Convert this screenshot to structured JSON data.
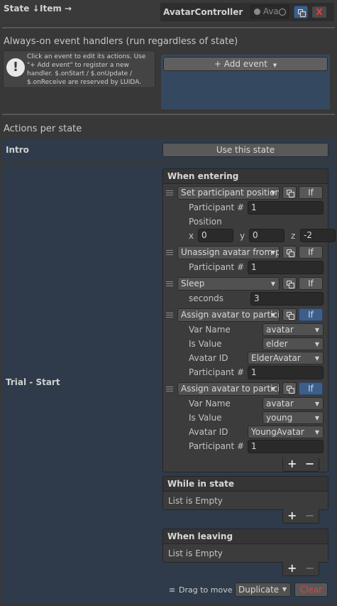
{
  "header": {
    "state_sort": "State ↓",
    "item_sort": "Item →",
    "avatar_controller_label": "AvatarController",
    "avatar_field_value": "Ava",
    "close_label": "X"
  },
  "always_on": {
    "title": "Always-on event handlers (run regardless of state)",
    "info_text": "Click an event to edit its actions. Use \"+ Add event\" to register a new handler. $.onStart / $.onUpdate / $.onReceive are reserved by LUIDA.",
    "add_event_label": "+ Add event"
  },
  "actions": {
    "title": "Actions per state",
    "intro": {
      "label": "Intro",
      "button": "Use this state"
    },
    "trial_label": "Trial - Start",
    "when_entering": {
      "title": "When entering",
      "items": [
        {
          "action": "Set participant position",
          "if_label": "If",
          "fields": {
            "participant_label": "Participant #",
            "participant_value": "1",
            "position_label": "Position",
            "x_label": "x",
            "x_value": "0",
            "y_label": "y",
            "y_value": "0",
            "z_label": "z",
            "z_value": "-2"
          }
        },
        {
          "action": "Unassign avatar from participant",
          "if_label": "If",
          "fields": {
            "participant_label": "Participant #",
            "participant_value": "1"
          }
        },
        {
          "action": "Sleep",
          "if_label": "If",
          "fields": {
            "seconds_label": "seconds",
            "seconds_value": "3"
          }
        },
        {
          "action": "Assign avatar to participant",
          "if_label": "If",
          "fields": {
            "var_name_label": "Var Name",
            "var_name_value": "avatar",
            "is_value_label": "Is Value",
            "is_value_value": "elder",
            "avatar_id_label": "Avatar ID",
            "avatar_id_value": "ElderAvatar",
            "participant_label": "Participant #",
            "participant_value": "1"
          }
        },
        {
          "action": "Assign avatar to participant",
          "if_label": "If",
          "fields": {
            "var_name_label": "Var Name",
            "var_name_value": "avatar",
            "is_value_label": "Is Value",
            "is_value_value": "young",
            "avatar_id_label": "Avatar ID",
            "avatar_id_value": "YoungAvatar",
            "participant_label": "Participant #",
            "participant_value": "1"
          }
        }
      ],
      "add_label": "+",
      "remove_label": "−"
    },
    "while_in_state": {
      "title": "While in state",
      "empty": "List is Empty",
      "add_label": "+",
      "remove_label": "−"
    },
    "when_leaving": {
      "title": "When leaving",
      "empty": "List is Empty",
      "add_label": "+",
      "remove_label": "−"
    },
    "footer": {
      "drag_label": "Drag to move",
      "duplicate_label": "Duplicate",
      "clear_label": "Clear"
    }
  },
  "colors": {
    "background": "#383838",
    "active_if": "#3e5e8a",
    "clear_red": "#e04040",
    "close_red": "#e04040"
  }
}
